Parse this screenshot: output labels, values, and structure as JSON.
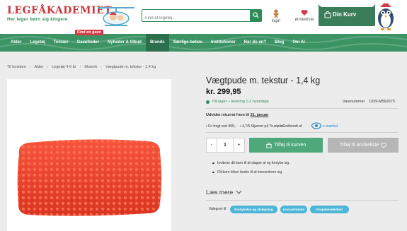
{
  "header": {
    "logo_title": "LEGFÅKADEMIET",
    "logo_subtitle": "Her leger børn sig klogere",
    "search_placeholder": "Find et legetøj...",
    "login_label": "login",
    "wishlist_label": "ønskeliste",
    "cart_label": "Din Kurv"
  },
  "nav": {
    "items": [
      "Alder",
      "Legetøj",
      "Temaer",
      "Gavefinder",
      "Nyheder & tilbud",
      "Brands",
      "Særlige behov",
      "Institutioner",
      "Har du en?",
      "Blog",
      "Om Al"
    ],
    "active_index": 5,
    "gift_tag": "Find en gave"
  },
  "breadcrumb": [
    "Til forsiden",
    "Alder",
    "Legetøj 4-6 år",
    "Motorik",
    "Vægtpude m. tekstur - 1,4 kg"
  ],
  "product": {
    "title": "Vægtpude m. tekstur - 1,4 kg",
    "price": "kr. 299,95",
    "stock": "På lager – levering 1-2 hverdage",
    "sku_label": "Varenummer",
    "sku": "1039-M592675",
    "returns_prefix": "Udvidet returret frem til",
    "returns_date": "31. januar",
    "usps": [
      "Fri fragt ved 499,-",
      "4,7/5 Stjerner på Trustpilot",
      "Godkendt af"
    ],
    "approval_brand": "e-mærket",
    "quantity": "1",
    "qty_minus": "-",
    "qty_plus": "+",
    "add_to_cart": "Tilføj til kurven",
    "add_to_wishlist": "Tilføj til ønskeliste",
    "bullets": [
      "Inviterer dit barn til at slappe af og fordybe sig.",
      "Dit barn bliver bedre til at koncentrere sig."
    ],
    "read_more": "Læs mere",
    "selected_for_label": "Valegnet til",
    "tags": [
      "Fordybelse og afslapning",
      "Koncentration",
      "Kropsbevidsthed"
    ]
  },
  "colors": {
    "brand_green": "#3c9465",
    "brand_red": "#c9363e",
    "cart_green": "#4fa87a",
    "tag_blue": "#4cb5d8",
    "pillow_red": "#f2452d"
  }
}
